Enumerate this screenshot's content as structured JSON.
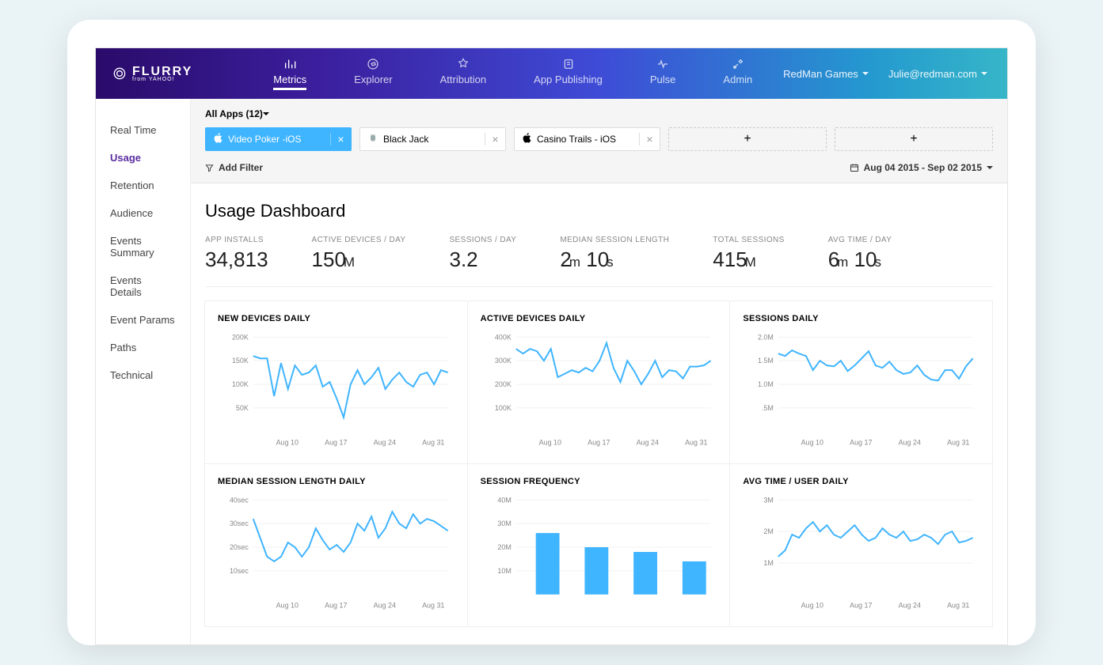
{
  "brand": {
    "name": "FLURRY",
    "sub": "from YAHOO!"
  },
  "topnav": [
    {
      "label": "Metrics",
      "active": true
    },
    {
      "label": "Explorer"
    },
    {
      "label": "Attribution"
    },
    {
      "label": "App Publishing"
    },
    {
      "label": "Pulse"
    },
    {
      "label": "Admin"
    }
  ],
  "account": {
    "company": "RedMan Games",
    "email": "Julie@redman.com"
  },
  "sidenav": [
    {
      "label": "Real Time"
    },
    {
      "label": "Usage",
      "active": true
    },
    {
      "label": "Retention"
    },
    {
      "label": "Audience"
    },
    {
      "label": "Events Summary"
    },
    {
      "label": "Events Details"
    },
    {
      "label": "Event Params"
    },
    {
      "label": "Paths"
    },
    {
      "label": "Technical"
    }
  ],
  "filters": {
    "all_apps": "All Apps (12)",
    "chips": [
      {
        "name": "Video Poker -iOS",
        "platform": "ios",
        "selected": true
      },
      {
        "name": "Black Jack",
        "platform": "android"
      },
      {
        "name": "Casino Trails - iOS",
        "platform": "ios"
      }
    ],
    "add_filter": "Add Filter",
    "date_range": "Aug 04 2015 - Sep 02 2015"
  },
  "dashboard": {
    "title": "Usage Dashboard",
    "stats": [
      {
        "label": "APP INSTALLS",
        "value": "34,813"
      },
      {
        "label": "ACTIVE DEVICES / DAY",
        "value": "150",
        "unit": "M"
      },
      {
        "label": "SESSIONS / DAY",
        "value": "3.2"
      },
      {
        "label": "MEDIAN SESSION LENGTH",
        "value_html": "2<small>m</small> 10<small>s</small>"
      },
      {
        "label": "TOTAL SESSIONS",
        "value": "415",
        "unit": "M"
      },
      {
        "label": "AVG TIME / DAY",
        "value_html": "6<small>m</small> 10<small>s</small>"
      }
    ]
  },
  "chart_data": [
    {
      "title": "NEW DEVICES DAILY",
      "type": "line",
      "yticks": [
        {
          "v": 50,
          "l": "50K"
        },
        {
          "v": 100,
          "l": "100K"
        },
        {
          "v": 150,
          "l": "150K"
        },
        {
          "v": 200,
          "l": "200K"
        }
      ],
      "xticks": [
        "Aug 10",
        "Aug 17",
        "Aug 24",
        "Aug 31"
      ],
      "y": [
        160,
        155,
        155,
        75,
        145,
        90,
        140,
        120,
        125,
        140,
        95,
        105,
        70,
        30,
        100,
        130,
        100,
        115,
        135,
        90,
        110,
        125,
        105,
        95,
        120,
        125,
        100,
        130,
        125
      ]
    },
    {
      "title": "ACTIVE DEVICES DAILY",
      "type": "line",
      "yticks": [
        {
          "v": 100,
          "l": "100K"
        },
        {
          "v": 200,
          "l": "200K"
        },
        {
          "v": 300,
          "l": "300K"
        },
        {
          "v": 400,
          "l": "400K"
        }
      ],
      "xticks": [
        "Aug 10",
        "Aug 17",
        "Aug 24",
        "Aug 31"
      ],
      "y": [
        350,
        330,
        350,
        340,
        300,
        350,
        230,
        245,
        260,
        250,
        270,
        255,
        300,
        375,
        270,
        210,
        300,
        255,
        200,
        245,
        300,
        230,
        260,
        255,
        225,
        275,
        275,
        280,
        300
      ]
    },
    {
      "title": "SESSIONS DAILY",
      "type": "line",
      "yticks": [
        {
          "v": 0.5,
          "l": ".5M"
        },
        {
          "v": 1.0,
          "l": "1.0M"
        },
        {
          "v": 1.5,
          "l": "1.5M"
        },
        {
          "v": 2.0,
          "l": "2.0M"
        }
      ],
      "xticks": [
        "Aug 10",
        "Aug 17",
        "Aug 24",
        "Aug 31"
      ],
      "y": [
        1.65,
        1.6,
        1.72,
        1.65,
        1.6,
        1.3,
        1.5,
        1.4,
        1.38,
        1.5,
        1.28,
        1.4,
        1.55,
        1.7,
        1.4,
        1.35,
        1.48,
        1.3,
        1.22,
        1.25,
        1.4,
        1.2,
        1.1,
        1.08,
        1.3,
        1.3,
        1.12,
        1.38,
        1.55
      ]
    },
    {
      "title": "MEDIAN SESSION LENGTH DAILY",
      "type": "line",
      "yticks": [
        {
          "v": 10,
          "l": "10sec"
        },
        {
          "v": 20,
          "l": "20sec"
        },
        {
          "v": 30,
          "l": "30sec"
        },
        {
          "v": 40,
          "l": "40sec"
        }
      ],
      "xticks": [
        "Aug 10",
        "Aug 17",
        "Aug 24",
        "Aug 31"
      ],
      "y": [
        32,
        24,
        16,
        14,
        16,
        22,
        20,
        16,
        20,
        28,
        23,
        19,
        21,
        18,
        22,
        30,
        27,
        33,
        24,
        28,
        35,
        30,
        28,
        34,
        30,
        32,
        31,
        29,
        27
      ]
    },
    {
      "title": "SESSION FREQUENCY",
      "type": "bar",
      "yticks": [
        {
          "v": 10,
          "l": "10M"
        },
        {
          "v": 20,
          "l": "20M"
        },
        {
          "v": 30,
          "l": "30M"
        },
        {
          "v": 40,
          "l": "40M"
        }
      ],
      "xticks": [],
      "y": [
        26,
        20,
        18,
        14
      ]
    },
    {
      "title": "AVG TIME / USER DAILY",
      "type": "line",
      "yticks": [
        {
          "v": 1,
          "l": "1M"
        },
        {
          "v": 2,
          "l": "2M"
        },
        {
          "v": 3,
          "l": "3M"
        }
      ],
      "xticks": [
        "Aug 10",
        "Aug 17",
        "Aug 24",
        "Aug 31"
      ],
      "y": [
        1.2,
        1.4,
        1.9,
        1.8,
        2.1,
        2.3,
        2.0,
        2.2,
        1.9,
        1.8,
        2.0,
        2.2,
        1.9,
        1.7,
        1.8,
        2.1,
        1.9,
        1.8,
        2.0,
        1.7,
        1.75,
        1.9,
        1.8,
        1.6,
        1.9,
        2.0,
        1.65,
        1.7,
        1.8
      ]
    }
  ]
}
